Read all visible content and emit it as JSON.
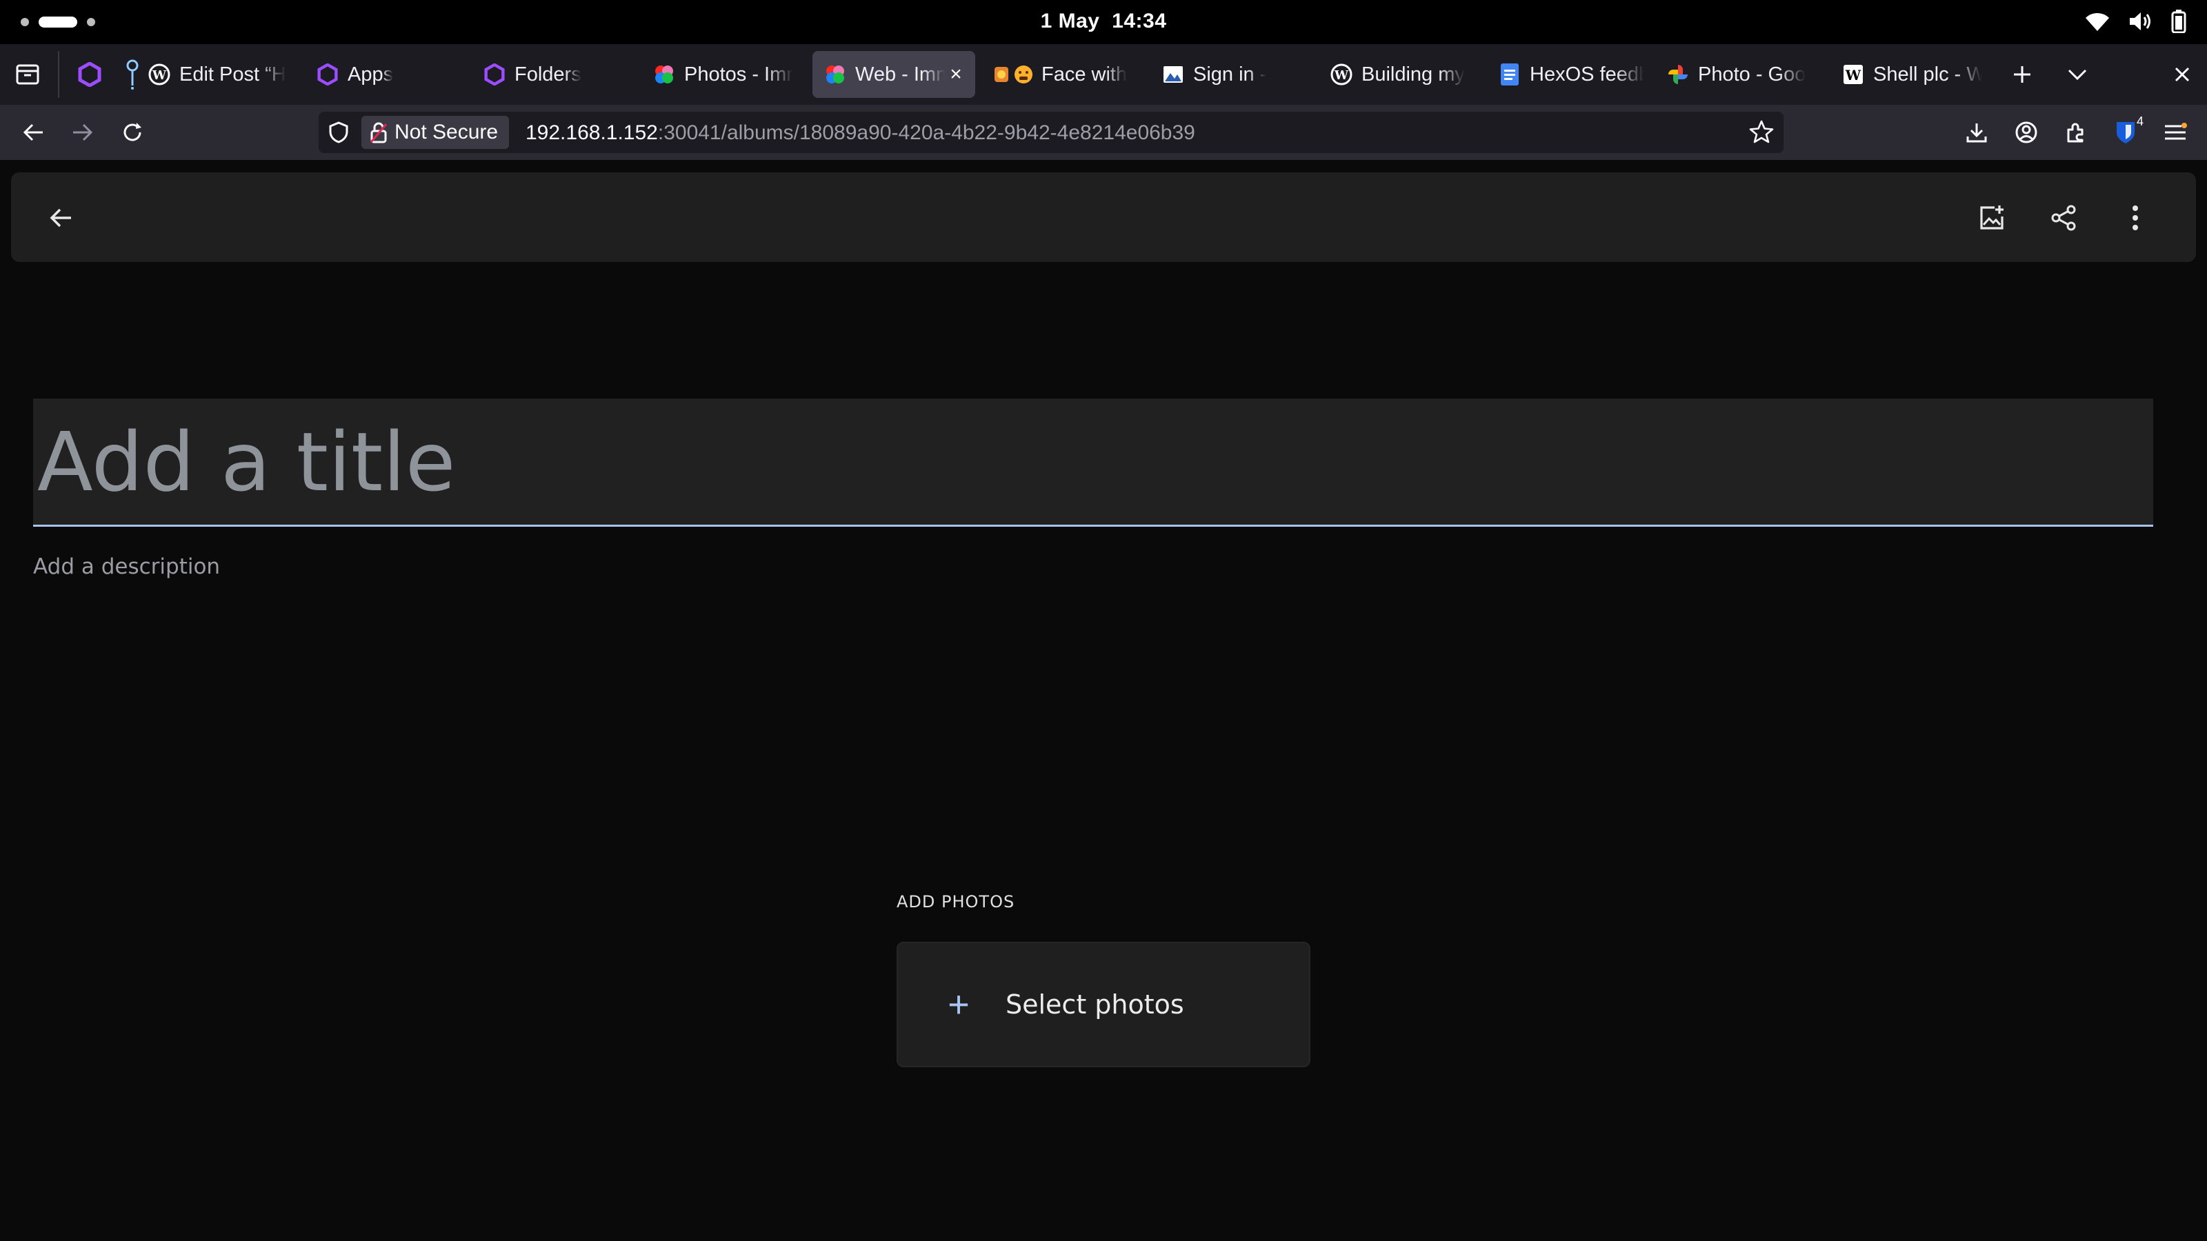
{
  "system": {
    "date": "1 May",
    "time": "14:34",
    "tray_icons": [
      "wifi-icon",
      "volume-icon",
      "battery-icon"
    ]
  },
  "browser": {
    "tabs": [
      {
        "title": "Edit Post “H",
        "icon": "wordpress-icon"
      },
      {
        "title": "Apps",
        "icon": "hexos-icon"
      },
      {
        "title": "Folders",
        "icon": "hexos-icon"
      },
      {
        "title": "Photos - Imm",
        "icon": "immich-icon"
      },
      {
        "title": "Web - Imm",
        "icon": "immich-icon",
        "active": true
      },
      {
        "title": "Face with",
        "icon": "emoji-icon"
      },
      {
        "title": "Sign in -",
        "icon": "signin-icon"
      },
      {
        "title": "Building my",
        "icon": "wordpress-icon"
      },
      {
        "title": "HexOS feedb",
        "icon": "docs-icon"
      },
      {
        "title": "Photo - Goo",
        "icon": "google-photos-icon"
      },
      {
        "title": "Shell plc - W",
        "icon": "wikipedia-icon"
      }
    ],
    "security_label": "Not Secure",
    "url_host": "192.168.1.152",
    "url_path": ":30041/albums/18089a90-420a-4b22-9b42-4e8214e06b39",
    "extension_badge": "4"
  },
  "album": {
    "title_placeholder": "Add a title",
    "description_placeholder": "Add a description",
    "add_photos_label": "ADD PHOTOS",
    "select_photos_label": "Select photos"
  },
  "colors": {
    "accent": "#a8c4f0",
    "page_bg": "#0a0a0a",
    "panel_bg": "#1f1f1f"
  }
}
